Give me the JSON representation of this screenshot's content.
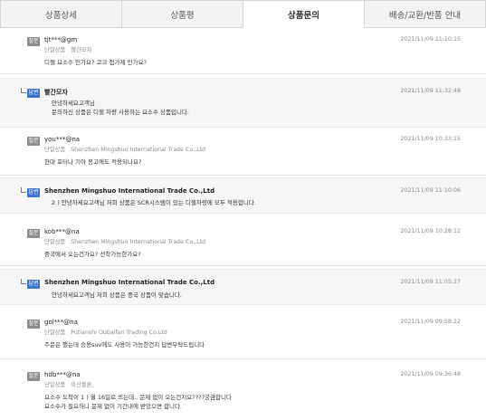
{
  "tabs": [
    {
      "label": "상품상세"
    },
    {
      "label": "상품평"
    },
    {
      "label": "상품문의"
    },
    {
      "label": "배송/교환/반품 안내"
    }
  ],
  "badges": {
    "question": "질문",
    "answer": "답변"
  },
  "product_label": "단일상품",
  "entries": [
    {
      "type": "question",
      "author": "tjt***@gm",
      "product": "빨간모자",
      "date": "2021/11/09 11:10:15",
      "lines": [
        "디젤 요소수 인가요? 코크 접가제 인가요?"
      ]
    },
    {
      "type": "answer",
      "author": "빨간모자",
      "date": "2021/11/09 11:32:48",
      "lines": [
        "안녕하세요고객님",
        "문의하신 상품은 디젤 차량 사용하는 요소수 상품입니다."
      ]
    },
    {
      "type": "question",
      "author": "you***@na",
      "product": "Shenzhen Mingshuo International Trade Co.,Ltd",
      "date": "2021/11/09 10:33:15",
      "lines": [
        "현대 포터나 기아 봉고에도 적용되나요?"
      ]
    },
    {
      "type": "answer",
      "author": "Shenzhen Mingshuo International Trade Co.,Ltd",
      "date": "2021/11/09 11:10:06",
      "lines": [
        "2 ) 안녕하세요고객님 저희 상품은 SCR시스템이 있는 디젤차량에 모두 적용합니다."
      ]
    },
    {
      "type": "question",
      "author": "kob***@na",
      "product": "Shenzhen Mingshuo International Trade Co.,Ltd",
      "date": "2021/11/09 10:28:12",
      "lines": [
        "중국에서 오는건가요? 선착가능한가요?"
      ]
    },
    {
      "type": "answer",
      "author": "Shenzhen Mingshuo International Trade Co.,Ltd",
      "date": "2021/11/09 11:05:27",
      "lines": [
        "안녕하세요고객님 저희 상품은 중국 상품이 맞습니다."
      ]
    },
    {
      "type": "question",
      "author": "gol***@na",
      "product": "Putianshi Oubaifan Trading Co.Ltd",
      "date": "2021/11/09 09:58:22",
      "lines": [
        "주문은 했는데 승용suv에도 사용이 가능한건지 답변부탁드립니다"
      ]
    },
    {
      "type": "question",
      "author": "hdb***@na",
      "product": "육산플론",
      "date": "2021/11/09 09:36:48",
      "lines": [
        "요소수 도착이 1 ) 월 16일로 뜨는데.. 문제 없이 오는건지요????궁금합니다",
        "요소수가 필요하니 문제 없이 기간내에 받았으면 합니다."
      ]
    }
  ]
}
